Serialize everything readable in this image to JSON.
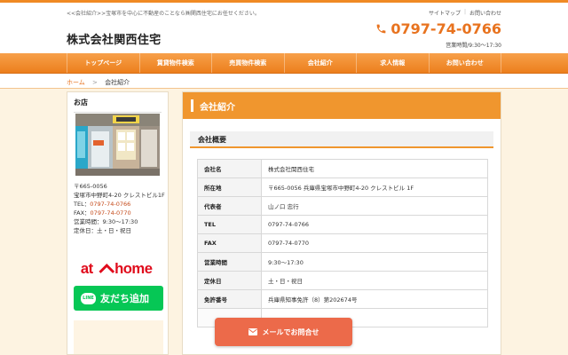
{
  "header": {
    "tagline": "<<会社紹介>>宝塚市を中心に不動産のことなら㈱関西住宅にお任せください。",
    "logo": "株式会社関西住宅",
    "util_links": [
      "サイトマップ",
      "お問い合わせ"
    ],
    "phone": "0797-74-0766",
    "hours": "営業時間/9:30〜17:30",
    "accent_color": "#f08a24"
  },
  "nav": {
    "items": [
      "トップページ",
      "賃貸物件検索",
      "売買物件検索",
      "会社紹介",
      "求人情報",
      "お問い合わせ"
    ]
  },
  "breadcrumb": {
    "home": "ホーム",
    "separator": ">",
    "current": "会社紹介"
  },
  "sidebar": {
    "title": "お店",
    "address_line1": "〒665-0056",
    "address_line2": "宝塚市中野町4-20 クレストビル1F",
    "tel_label": "TEL：",
    "tel": "0797-74-0766",
    "fax_label": "FAX：",
    "fax": "0797-74-0770",
    "hours": "営業時間：9:30〜17:30",
    "holiday": "定休日：土・日・祝日",
    "athome_logo": "at home",
    "line_button": "友だち追加",
    "line_logo": "LINE"
  },
  "main": {
    "title": "会社紹介",
    "section_title": "会社概要",
    "rows": [
      {
        "key": "会社名",
        "value": "株式会社関西住宅"
      },
      {
        "key": "所在地",
        "value": "〒665-0056 兵庫県宝塚市中野町4-20 クレストビル 1F"
      },
      {
        "key": "代表者",
        "value": "山ノ口 忠行"
      },
      {
        "key": "TEL",
        "value": "0797-74-0766"
      },
      {
        "key": "FAX",
        "value": "0797-74-0770"
      },
      {
        "key": "営業時間",
        "value": "9:30〜17:30"
      },
      {
        "key": "定休日",
        "value": "土・日・祝日"
      },
      {
        "key": "免許番号",
        "value": "兵庫県知事免許（8）第202674号"
      }
    ]
  },
  "cta": {
    "label": "メールでお問合せ",
    "color": "#ec6a4a"
  }
}
